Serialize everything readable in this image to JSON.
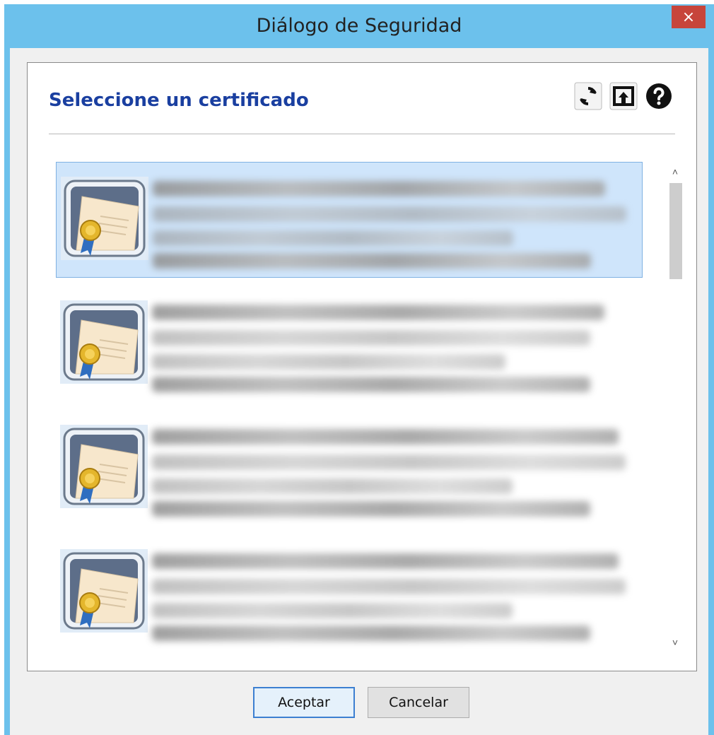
{
  "window": {
    "title": "Diálogo de Seguridad",
    "close_glyph": "×"
  },
  "dialog": {
    "heading": "Seleccione un certificado",
    "toolbar": [
      {
        "icon": "refresh-icon"
      },
      {
        "icon": "import-icon"
      },
      {
        "icon": "help-icon"
      }
    ]
  },
  "certificates": {
    "items": [
      {
        "selected": true,
        "icon": "certificate-icon"
      },
      {
        "selected": false,
        "icon": "certificate-icon"
      },
      {
        "selected": false,
        "icon": "certificate-icon"
      },
      {
        "selected": false,
        "icon": "certificate-icon"
      }
    ],
    "scroll": {
      "up": "˄",
      "down": "˅"
    }
  },
  "buttons": {
    "accept": "Aceptar",
    "cancel": "Cancelar"
  },
  "colors": {
    "titlebar": "#6cc1ec",
    "close": "#c7453b",
    "heading": "#1a3fa0",
    "selection": "#cfe5fb"
  }
}
